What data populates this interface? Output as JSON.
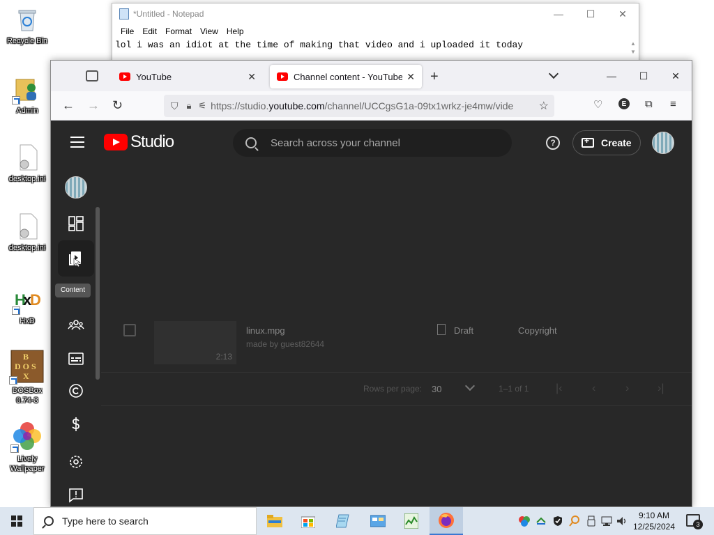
{
  "desktop": {
    "icons": [
      {
        "label": "Recycle Bin"
      },
      {
        "label": "Admin"
      },
      {
        "label": "desktop.ini"
      },
      {
        "label": "desktop.ini"
      },
      {
        "label": "HxD"
      },
      {
        "label": "DOSBox 0.74-3"
      },
      {
        "label": "Lively Wallpaper"
      }
    ]
  },
  "notepad": {
    "title": "*Untitled - Notepad",
    "menu": [
      "File",
      "Edit",
      "Format",
      "View",
      "Help"
    ],
    "text": "lol i was an idiot at the time of making that video and i uploaded it today"
  },
  "browser": {
    "tabs": [
      {
        "title": "YouTube"
      },
      {
        "title": "Channel content - YouTube Stu"
      }
    ],
    "url_prefix": "https://studio.",
    "url_domain": "youtube.com",
    "url_path": "/channel/UCCgsG1a-09tx1wrkz-je4mw/vide",
    "account_initial": "E"
  },
  "studio": {
    "logo_text": "Studio",
    "search_placeholder": "Search across your channel",
    "help_label": "?",
    "create_label": "Create",
    "tooltip": "Content",
    "video": {
      "title": "linux.mpg",
      "description": "made by guest82644",
      "duration": "2:13",
      "visibility": "Draft",
      "restrictions": "Copyright"
    },
    "pagination": {
      "rows_per_page_label": "Rows per page:",
      "rows_per_page_value": "30",
      "range": "1–1 of 1"
    }
  },
  "taskbar": {
    "search_placeholder": "Type here to search",
    "time": "9:10 AM",
    "date": "12/25/2024",
    "notification_count": "3"
  },
  "colors": {
    "studio_bg": "#282828",
    "youtube_red": "#ff0000",
    "taskbar_bg": "#dde6f0"
  }
}
